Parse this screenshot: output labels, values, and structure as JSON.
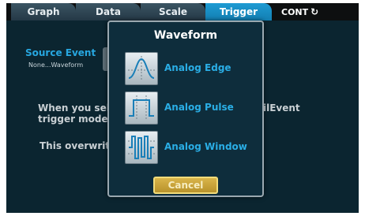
{
  "tabs": [
    {
      "label": "Graph"
    },
    {
      "label": "Data"
    },
    {
      "label": "Scale"
    },
    {
      "label": "Trigger"
    }
  ],
  "cont_label": "CONT",
  "cont_icon": "refresh-icon",
  "page": {
    "source_event_title": "Source Event",
    "source_event_value": "None...Waveform",
    "body_line_1": "When you sele",
    "body_line_2": "trigger model",
    "body_line_3": "This overwrit",
    "body_line_right": "ilEvent"
  },
  "modal": {
    "title": "Waveform",
    "options": [
      {
        "label": "Analog Edge",
        "icon": "analog-edge-icon"
      },
      {
        "label": "Analog Pulse",
        "icon": "analog-pulse-icon"
      },
      {
        "label": "Analog Window",
        "icon": "analog-window-icon"
      }
    ],
    "cancel_label": "Cancel"
  },
  "colors": {
    "accent": "#1e9bd3",
    "background": "#0b2530",
    "label": "#2aaee6",
    "cancel": "#c9a63d"
  }
}
